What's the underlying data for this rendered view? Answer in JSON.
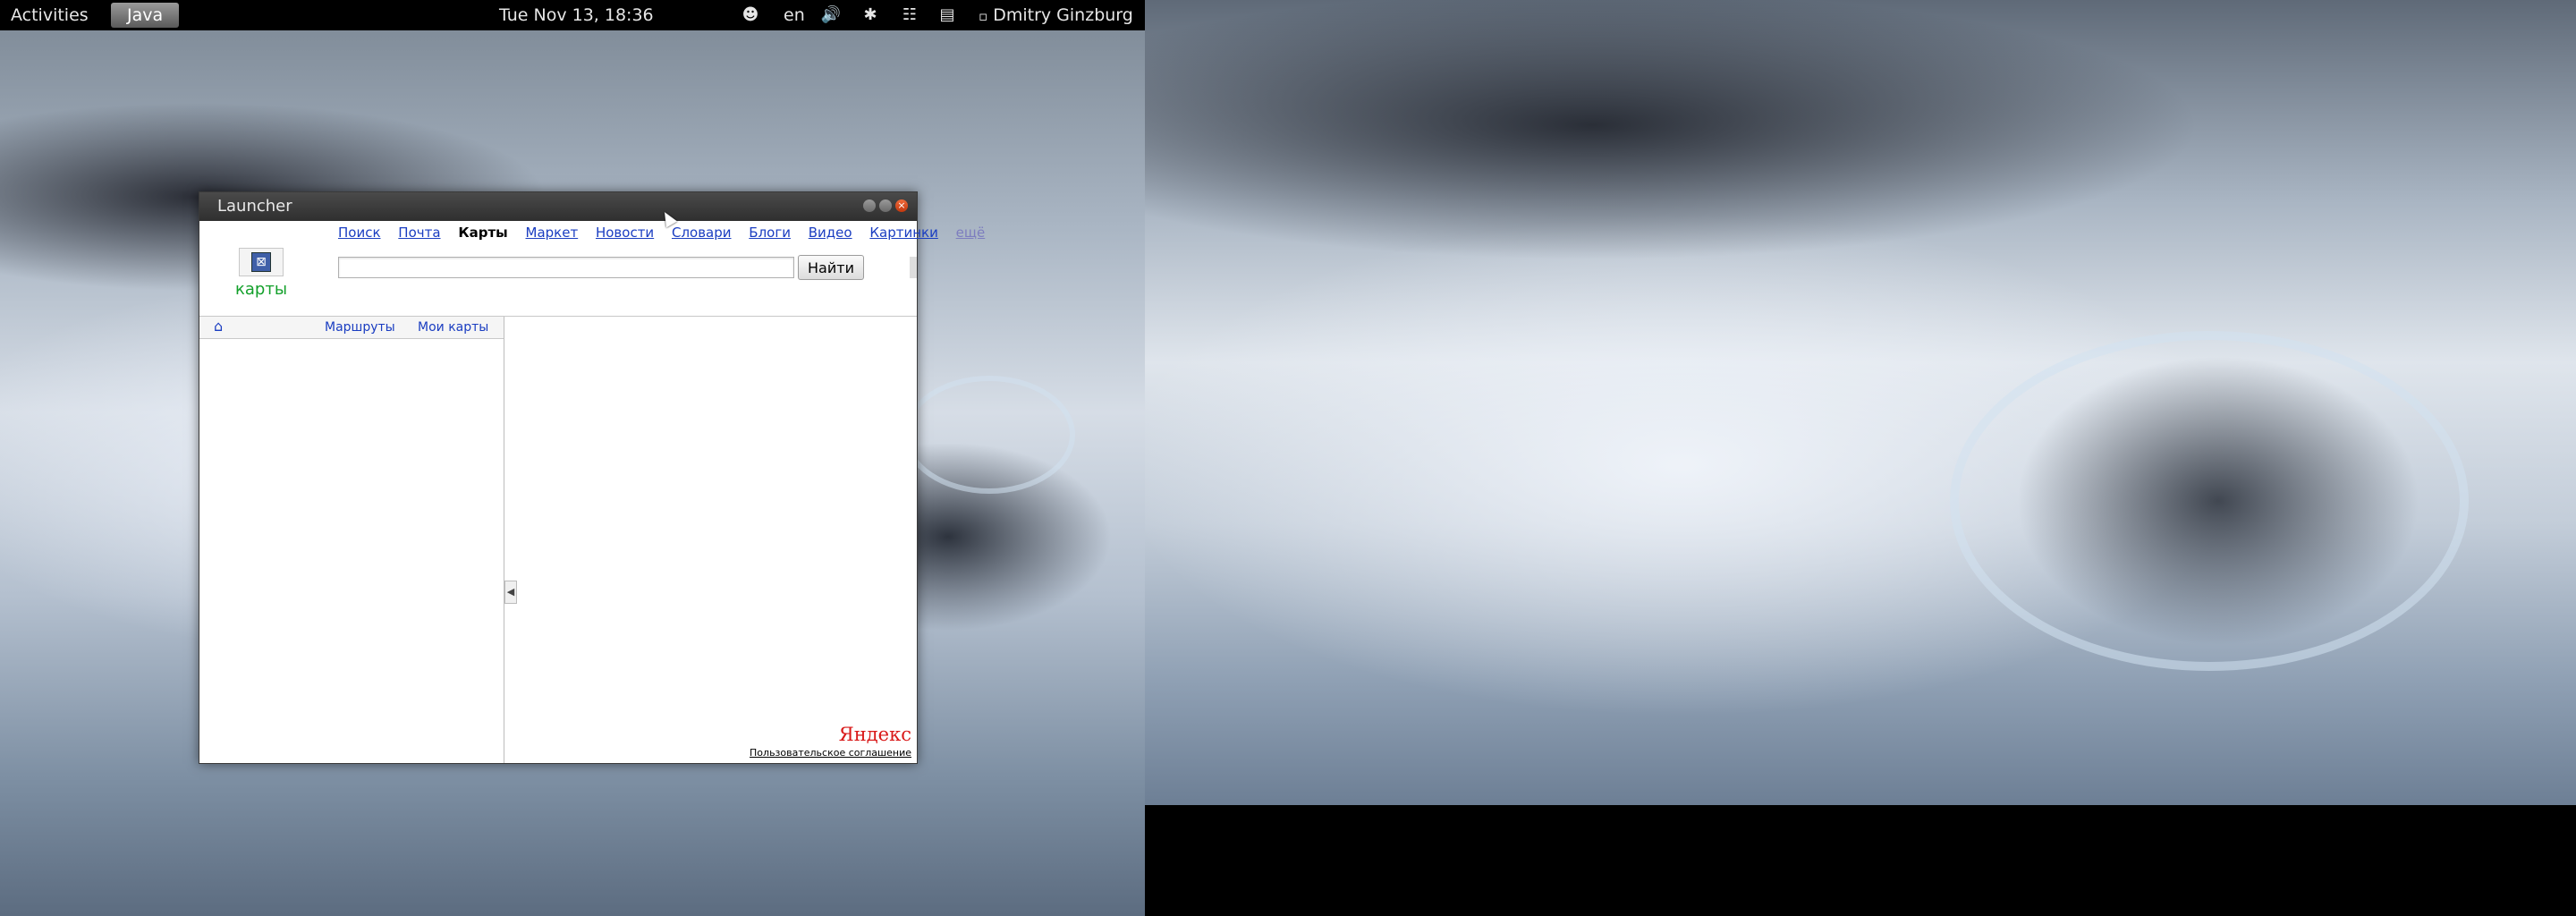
{
  "topbar": {
    "activities": "Activities",
    "app_menu": "Java",
    "clock": "Tue Nov 13, 18:36",
    "lang": "en",
    "user": "Dmitry Ginzburg"
  },
  "window": {
    "title": "Launcher"
  },
  "yandex": {
    "nav": [
      "Поиск",
      "Почта",
      "Карты",
      "Маркет",
      "Новости",
      "Словари",
      "Блоги",
      "Видео",
      "Картинки",
      "ещё"
    ],
    "logo_label": "карты",
    "search_button": "Найти",
    "search_value": "",
    "panel": {
      "routes": "Маршруты",
      "my_maps": "Мои карты"
    },
    "brand": "Яндекс",
    "agreement": "Пользовательское соглашение"
  },
  "colors": {
    "link": "#1a3dc1",
    "logo_green": "#13a02b",
    "brand_red": "#d91a1a",
    "close_button": "#e0501e"
  },
  "icons": [
    "accessibility-icon",
    "volume-icon",
    "bluetooth-icon",
    "network-icon",
    "clipboard-icon",
    "chat-status-icon",
    "home-icon",
    "close-icon",
    "minimize-icon",
    "maximize-icon",
    "collapse-arrow-icon"
  ]
}
